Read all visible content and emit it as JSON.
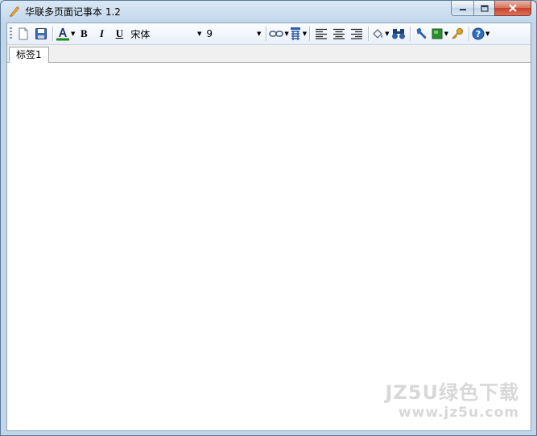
{
  "window": {
    "title": "华联多页面记事本 1.2"
  },
  "toolbar": {
    "font_name": "宋体",
    "font_size": "9",
    "bold_label": "B",
    "italic_label": "I",
    "underline_label": "U",
    "font_color": "#1a8a1a"
  },
  "tabs": [
    {
      "label": "标签1"
    }
  ],
  "watermark": {
    "line1": "JZ5U绿色下载",
    "line2": "www.jz5u.com"
  }
}
